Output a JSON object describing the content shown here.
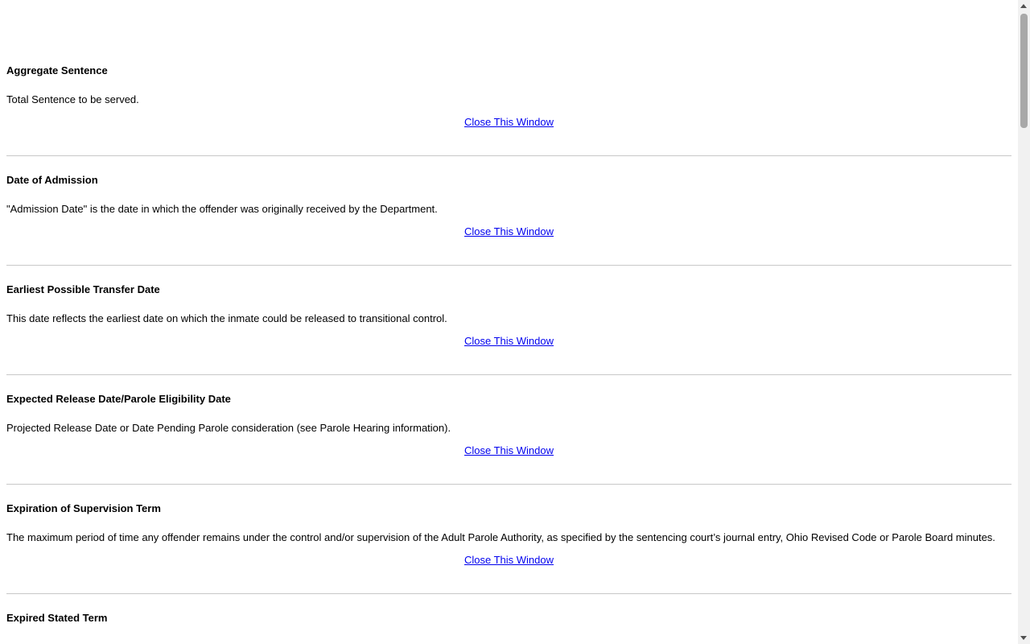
{
  "glossary": {
    "close_label": "Close This Window",
    "entries": [
      {
        "term": "Aggregate Sentence",
        "definition": "Total Sentence to be served."
      },
      {
        "term": "Date of Admission",
        "definition": "\"Admission Date\" is the date in which the offender was originally received by the Department."
      },
      {
        "term": "Earliest Possible Transfer Date",
        "definition": "This date reflects the earliest date on which the inmate could be released to transitional control."
      },
      {
        "term": "Expected Release Date/Parole Eligibility Date",
        "definition": "Projected Release Date or Date Pending Parole consideration (see Parole Hearing information)."
      },
      {
        "term": "Expiration of Supervision Term",
        "definition": "The maximum period of time any offender remains under the control and/or supervision of the Adult Parole Authority, as specified by the sentencing court’s journal entry, Ohio Revised Code or Parole Board minutes."
      },
      {
        "term": "Expired Stated Term",
        "definition": ""
      }
    ]
  },
  "scrollbar": {
    "position_fraction": 0.0
  }
}
